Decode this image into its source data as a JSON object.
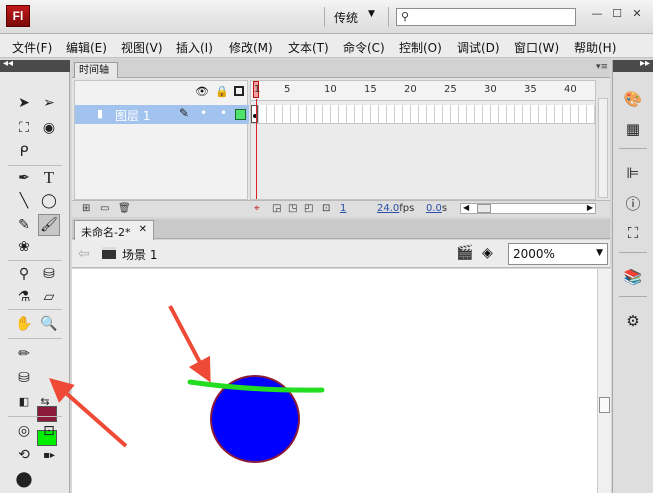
{
  "app": {
    "logo": "Fl",
    "workspace": "传统",
    "search_placeholder": ""
  },
  "menu": [
    "文件(F)",
    "编辑(E)",
    "视图(V)",
    "插入(I)",
    "修改(M)",
    "文本(T)",
    "命令(C)",
    "控制(O)",
    "调试(D)",
    "窗口(W)",
    "帮助(H)"
  ],
  "timeline": {
    "tab_label": "时间轴",
    "layer_name": "图层 1",
    "frame_numbers": [
      "1",
      "5",
      "10",
      "15",
      "20",
      "25",
      "30",
      "35",
      "40"
    ],
    "current_frame": "1",
    "fps": "24.0",
    "fps_unit": "fps",
    "time": "0.0",
    "time_unit": "s"
  },
  "document": {
    "tab_label": "未命名-2*",
    "scene_label": "场景 1",
    "zoom": "2000%"
  },
  "colors": {
    "stroke": "#8b1a3a",
    "fill": "#00ee00",
    "circle_fill": "#0000ff",
    "circle_stroke": "#8b1a3a",
    "line": "#22dd22",
    "arrow": "#ef4a37"
  }
}
